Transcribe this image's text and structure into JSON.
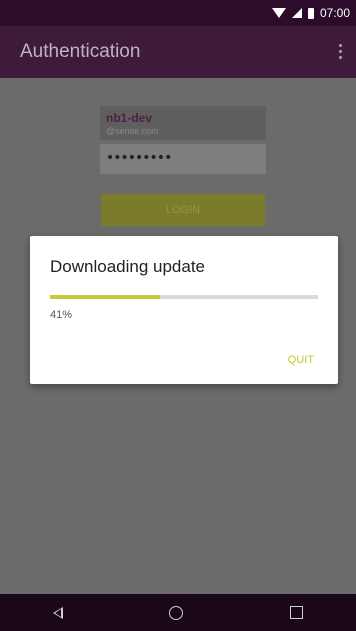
{
  "status_bar": {
    "time": "07:00"
  },
  "app_bar": {
    "title": "Authentication"
  },
  "login": {
    "username": "nb1-dev",
    "domain": "@sense.com",
    "password": "•••••••••",
    "login_label": "LOGIN"
  },
  "dialog": {
    "title": "Downloading update",
    "progress_percent": 41,
    "progress_text": "41%",
    "quit_label": "QUIT",
    "accent_color": "#c5cc3a"
  },
  "nav": {
    "back_icon": "back-triangle-icon",
    "home_icon": "home-circle-icon",
    "recents_icon": "recents-square-icon"
  }
}
